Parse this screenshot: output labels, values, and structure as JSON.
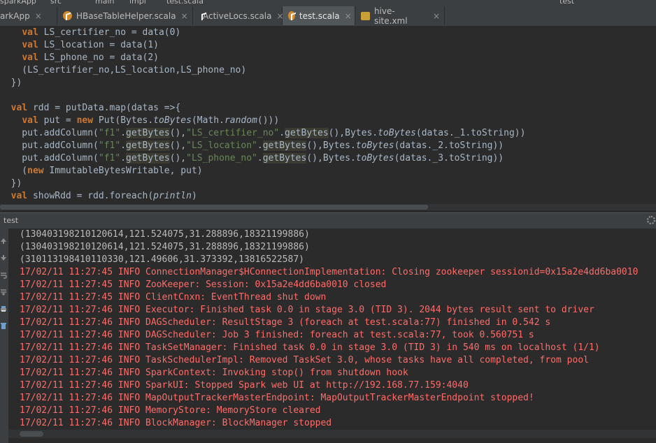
{
  "topbar": {
    "crumbs": [
      "sparkApp",
      "src",
      "main",
      "impl",
      "test.scala"
    ],
    "run_config": "test"
  },
  "tabs": [
    {
      "label": "arkApp",
      "type": "project",
      "active": false
    },
    {
      "label": "HBaseTableHelper.scala",
      "type": "scala",
      "active": false
    },
    {
      "label": "ActiveLocs.scala",
      "type": "scala",
      "active": false
    },
    {
      "label": "test.scala",
      "type": "scala",
      "active": true
    },
    {
      "label": "hive-site.xml",
      "type": "xml",
      "active": false
    }
  ],
  "editor": {
    "lines": [
      "    val LS_certifier_no = data(0)",
      "    val LS_location = data(1)",
      "    val LS_phone_no = data(2)",
      "    (LS_certifier_no,LS_location,LS_phone_no)",
      "  })",
      "",
      "  val rdd = putData.map(datas =>{",
      "    val put = new Put(Bytes.toBytes(Math.random()))",
      "    put.addColumn(\"f1\".getBytes(),\"LS_certifier_no\".getBytes(),Bytes.toBytes(datas._1.toString))",
      "    put.addColumn(\"f1\".getBytes(),\"LS_location\".getBytes(),Bytes.toBytes(datas._2.toString))",
      "    put.addColumn(\"f1\".getBytes(),\"LS_phone_no\".getBytes(),Bytes.toBytes(datas._3.toString))",
      "    (new ImmutableBytesWritable, put)",
      "  })",
      "  val showRdd = rdd.foreach(println)"
    ]
  },
  "run_panel": {
    "title": "test"
  },
  "console": {
    "lines": [
      {
        "text": "(130403198210120614,121.524075,31.288896,18321199886)",
        "kind": "out"
      },
      {
        "text": "(130403198210120614,121.524075,31.288896,18321199886)",
        "kind": "out"
      },
      {
        "text": "(310113198410110330,121.49606,31.373392,13816522587)",
        "kind": "out"
      },
      {
        "text": "17/02/11 11:27:45 INFO ConnectionManager$HConnectionImplementation: Closing zookeeper sessionid=0x15a2e4dd6ba0010",
        "kind": "err"
      },
      {
        "text": "17/02/11 11:27:45 INFO ZooKeeper: Session: 0x15a2e4dd6ba0010 closed",
        "kind": "err"
      },
      {
        "text": "17/02/11 11:27:45 INFO ClientCnxn: EventThread shut down",
        "kind": "err"
      },
      {
        "text": "17/02/11 11:27:46 INFO Executor: Finished task 0.0 in stage 3.0 (TID 3). 2044 bytes result sent to driver",
        "kind": "err"
      },
      {
        "text": "17/02/11 11:27:46 INFO DAGScheduler: ResultStage 3 (foreach at test.scala:77) finished in 0.542 s",
        "kind": "err"
      },
      {
        "text": "17/02/11 11:27:46 INFO DAGScheduler: Job 3 finished: foreach at test.scala:77, took 0.560751 s",
        "kind": "err"
      },
      {
        "text": "17/02/11 11:27:46 INFO TaskSetManager: Finished task 0.0 in stage 3.0 (TID 3) in 540 ms on localhost (1/1)",
        "kind": "err"
      },
      {
        "text": "17/02/11 11:27:46 INFO TaskSchedulerImpl: Removed TaskSet 3.0, whose tasks have all completed, from pool",
        "kind": "err"
      },
      {
        "text": "17/02/11 11:27:46 INFO SparkContext: Invoking stop() from shutdown hook",
        "kind": "err"
      },
      {
        "text": "17/02/11 11:27:46 INFO SparkUI: Stopped Spark web UI at http://192.168.77.159:4040",
        "kind": "err"
      },
      {
        "text": "17/02/11 11:27:46 INFO MapOutputTrackerMasterEndpoint: MapOutputTrackerMasterEndpoint stopped!",
        "kind": "err"
      },
      {
        "text": "17/02/11 11:27:46 INFO MemoryStore: MemoryStore cleared",
        "kind": "err"
      },
      {
        "text": "17/02/11 11:27:46 INFO BlockManager: BlockManager stopped",
        "kind": "err"
      }
    ]
  },
  "colors": {
    "editor_bg": "#2b2b2b",
    "keyword": "#cc7832",
    "string": "#6a8759",
    "plain": "#a9b7c6",
    "console_out": "#bbbbbb",
    "console_err": "#ff6b68"
  },
  "icons": {
    "tab_file": "scala-file-icon",
    "tab_close": "close-icon",
    "sidebar": [
      "up-arrow-icon",
      "down-arrow-icon",
      "soft-wrap-icon",
      "scroll-to-end-icon",
      "print-icon",
      "trash-icon"
    ],
    "settings": "gear-icon"
  }
}
